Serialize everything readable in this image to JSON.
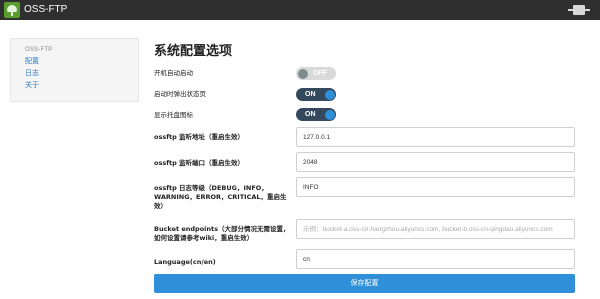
{
  "app": {
    "title": "OSS-FTP"
  },
  "sidebar": {
    "header": "OSS-FTP",
    "items": [
      {
        "label": "配置"
      },
      {
        "label": "日志"
      },
      {
        "label": "关于"
      }
    ]
  },
  "page": {
    "title": "系统配置选项"
  },
  "settings": {
    "autostart": {
      "label": "开机自动启动",
      "state": "OFF"
    },
    "show_status": {
      "label": "启动时弹出状态页",
      "state": "ON"
    },
    "tray_icon": {
      "label": "显示托盘图标",
      "state": "ON"
    },
    "listen_addr": {
      "label": "ossftp 监听地址（重启生效）",
      "value": "127.0.0.1"
    },
    "listen_port": {
      "label": "ossftp 监听端口（重启生效）",
      "value": "2048"
    },
    "log_level": {
      "label_1": "ossftp 日志等级（DEBUG，INFO，",
      "label_2": "WARNING，ERROR，CRITICAL，重启生",
      "label_3": "效）",
      "value": "INFO"
    },
    "bucket_endpoints": {
      "label_1": "Bucket endpoints（大部分情况无需设置，",
      "label_2": "如何设置请参考wiki，重启生效）",
      "placeholder": "示例：bucket-a.oss-cn-hangzhou.aliyuncs.com, bucket-b.oss-cn-qingdao.aliyuncs.com"
    },
    "language": {
      "label": "Language(cn/en)",
      "value": "cn"
    }
  },
  "actions": {
    "save_label": "保存配置"
  }
}
